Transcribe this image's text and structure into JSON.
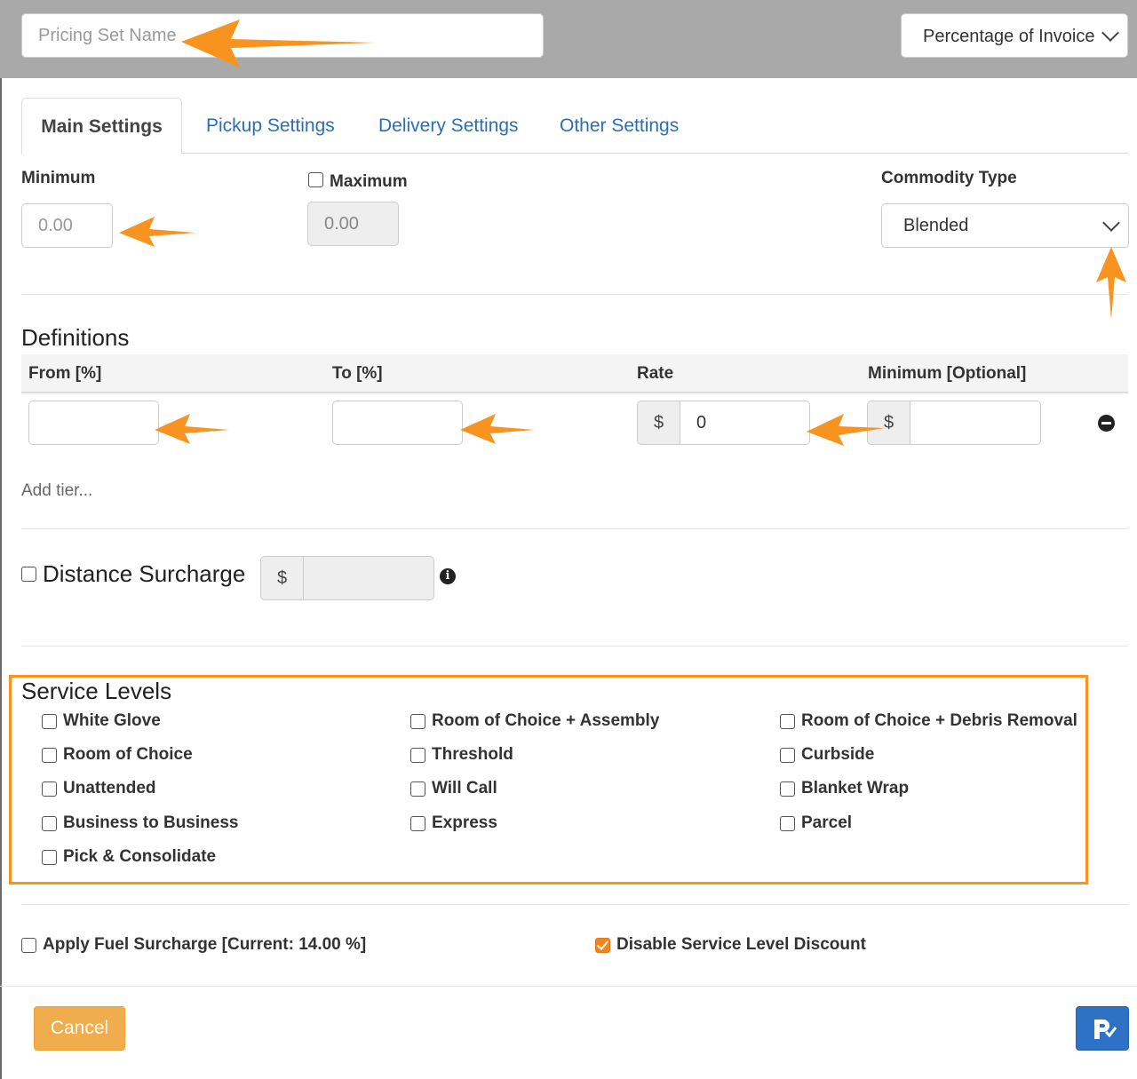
{
  "header": {
    "name_placeholder": "Pricing Set Name",
    "pricing_type_value": "Percentage of Invoice"
  },
  "tabs": [
    {
      "label": "Main Settings",
      "active": true
    },
    {
      "label": "Pickup Settings"
    },
    {
      "label": "Delivery Settings"
    },
    {
      "label": "Other Settings"
    }
  ],
  "main": {
    "minimum_label": "Minimum",
    "minimum_placeholder": "0.00",
    "maximum_label": "Maximum",
    "maximum_checked": false,
    "maximum_placeholder": "0.00",
    "commodity_label": "Commodity Type",
    "commodity_value": "Blended"
  },
  "definitions": {
    "title": "Definitions",
    "columns": [
      "From [%]",
      "To [%]",
      "Rate",
      "Minimum [Optional]"
    ],
    "row": {
      "from": "",
      "to": "",
      "rate_prefix": "$",
      "rate": "0",
      "min_prefix": "$",
      "min": ""
    },
    "add_tier": "Add tier..."
  },
  "distance_surcharge": {
    "label": "Distance Surcharge",
    "checked": false,
    "prefix": "$",
    "value": "",
    "info_icon": "i"
  },
  "service_levels": {
    "title": "Service Levels",
    "items": [
      {
        "label": "White Glove",
        "checked": false
      },
      {
        "label": "Room of Choice",
        "checked": false
      },
      {
        "label": "Unattended",
        "checked": false
      },
      {
        "label": "Business to Business",
        "checked": false
      },
      {
        "label": "Pick & Consolidate",
        "checked": false
      },
      {
        "label": "Room of Choice + Assembly",
        "checked": false
      },
      {
        "label": "Threshold",
        "checked": false
      },
      {
        "label": "Will Call",
        "checked": false
      },
      {
        "label": "Express",
        "checked": false
      },
      {
        "label": "Room of Choice + Debris Removal",
        "checked": false
      },
      {
        "label": "Curbside",
        "checked": false
      },
      {
        "label": "Blanket Wrap",
        "checked": false
      },
      {
        "label": "Parcel",
        "checked": false
      }
    ]
  },
  "options": {
    "fuel_surcharge_label": "Apply Fuel Surcharge [Current: 14.00 %]",
    "fuel_surcharge_checked": false,
    "disable_discount_label": "Disable Service Level Discount",
    "disable_discount_checked": true
  },
  "footer": {
    "cancel_label": "Cancel",
    "save_icon": "save-icon"
  },
  "colors": {
    "accent_orange": "#f7931e",
    "header_gray": "#a9a9a9",
    "link_blue": "#2a6fb6",
    "save_blue": "#2e72c5",
    "cancel_orange": "#f0ad4e"
  }
}
